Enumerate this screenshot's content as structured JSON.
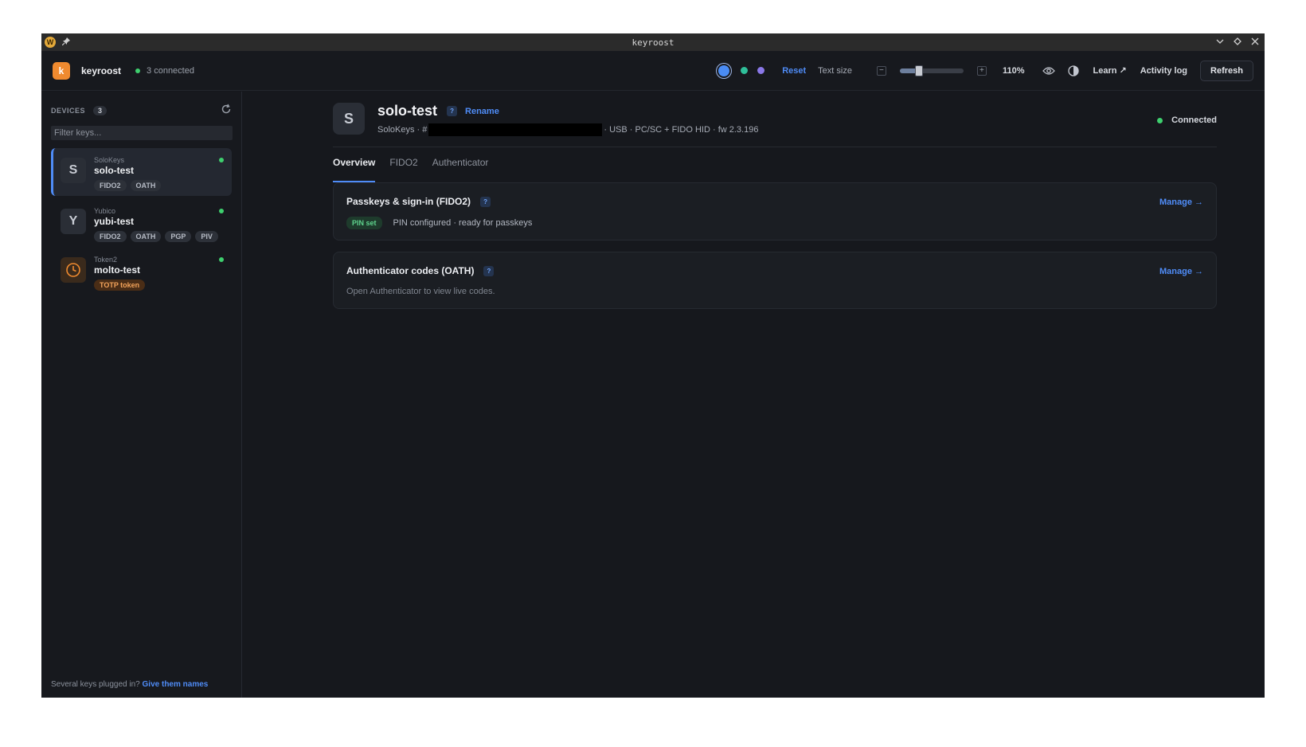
{
  "window": {
    "title": "keyroost"
  },
  "header": {
    "app_name": "keyroost",
    "connected_text": "3 connected",
    "reset_label": "Reset",
    "text_size_label": "Text size",
    "decrease": "−",
    "increase": "+",
    "text_size_level": 0.3,
    "zoom_value": "110%",
    "learn_label": "Learn ↗",
    "activity_log_label": "Activity log",
    "refresh_label": "Refresh",
    "theme_colors": [
      "#4a8cf5",
      "#2fbf9a",
      "#8a78e8"
    ]
  },
  "sidebar": {
    "title": "DEVICES",
    "count": "3",
    "filter_placeholder": "Filter keys...",
    "devices": [
      {
        "avatar": "S",
        "vendor": "SoloKeys",
        "name": "solo-test",
        "chips": [
          "FIDO2",
          "OATH"
        ],
        "status": "connected"
      },
      {
        "avatar": "Y",
        "vendor": "Yubico",
        "name": "yubi-test",
        "chips": [
          "FIDO2",
          "OATH",
          "PGP",
          "PIV"
        ],
        "status": "connected"
      },
      {
        "avatar": "clock-icon",
        "vendor": "Token2",
        "name": "molto-test",
        "chips": [
          "TOTP token"
        ],
        "status": "connected"
      }
    ],
    "footer_text": "Several keys plugged in?",
    "footer_link": "Give them names"
  },
  "device": {
    "avatar": "S",
    "name": "solo-test",
    "help": "?",
    "rename_label": "Rename",
    "sub_prefix": "SoloKeys · #",
    "sub_suffix": "· USB · PC/SC + FIDO HID · fw 2.3.196",
    "status": "Connected"
  },
  "tabs": [
    "Overview",
    "FIDO2",
    "Authenticator"
  ],
  "cards": {
    "fido2": {
      "title": "Passkeys & sign-in (FIDO2)",
      "manage": "Manage →",
      "badge": "PIN set",
      "text": "PIN configured · ready for passkeys"
    },
    "oath": {
      "title": "Authenticator codes (OATH)",
      "manage": "Manage →",
      "text": "Open Authenticator to view live codes."
    }
  }
}
